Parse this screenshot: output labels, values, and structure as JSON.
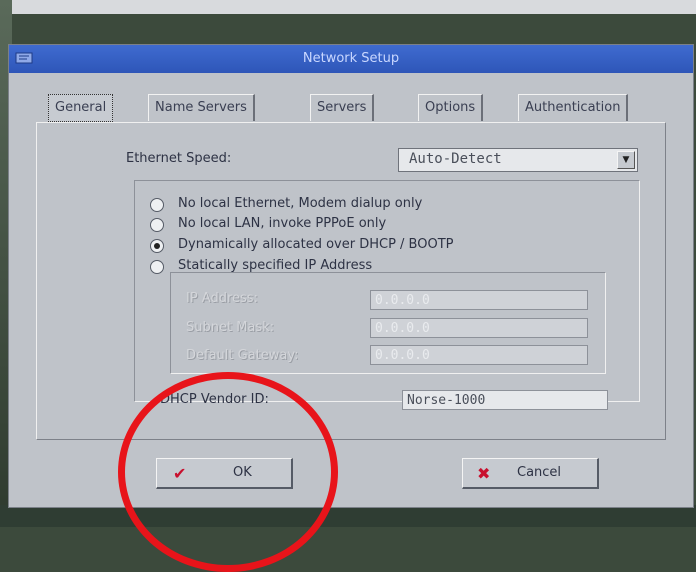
{
  "window": {
    "title": "Network Setup"
  },
  "tabs": [
    {
      "label": "General"
    },
    {
      "label": "Name Servers"
    },
    {
      "label": "Servers"
    },
    {
      "label": "Options"
    },
    {
      "label": "Authentication"
    }
  ],
  "general": {
    "ethernet_speed_label": "Ethernet Speed:",
    "ethernet_speed_value": "Auto-Detect",
    "options": [
      {
        "label": "No local Ethernet, Modem dialup only",
        "checked": false
      },
      {
        "label": "No local LAN, invoke PPPoE only",
        "checked": false
      },
      {
        "label": "Dynamically allocated over DHCP / BOOTP",
        "checked": true
      },
      {
        "label": "Statically specified IP Address",
        "checked": false
      }
    ],
    "ip_address_label": "IP Address:",
    "ip_address_value": "0.0.0.0",
    "subnet_mask_label": "Subnet Mask:",
    "subnet_mask_value": "0.0.0.0",
    "default_gateway_label": "Default Gateway:",
    "default_gateway_value": "0.0.0.0",
    "dhcp_vendor_id_label": "DHCP Vendor ID:",
    "dhcp_vendor_id_value": "Norse-1000"
  },
  "buttons": {
    "ok_label": "OK",
    "cancel_label": "Cancel"
  },
  "colors": {
    "titlebar": "#2e56b8",
    "ok_check": "#c8102e",
    "cancel_x": "#c8102e",
    "annotation_circle": "#e8141a"
  }
}
